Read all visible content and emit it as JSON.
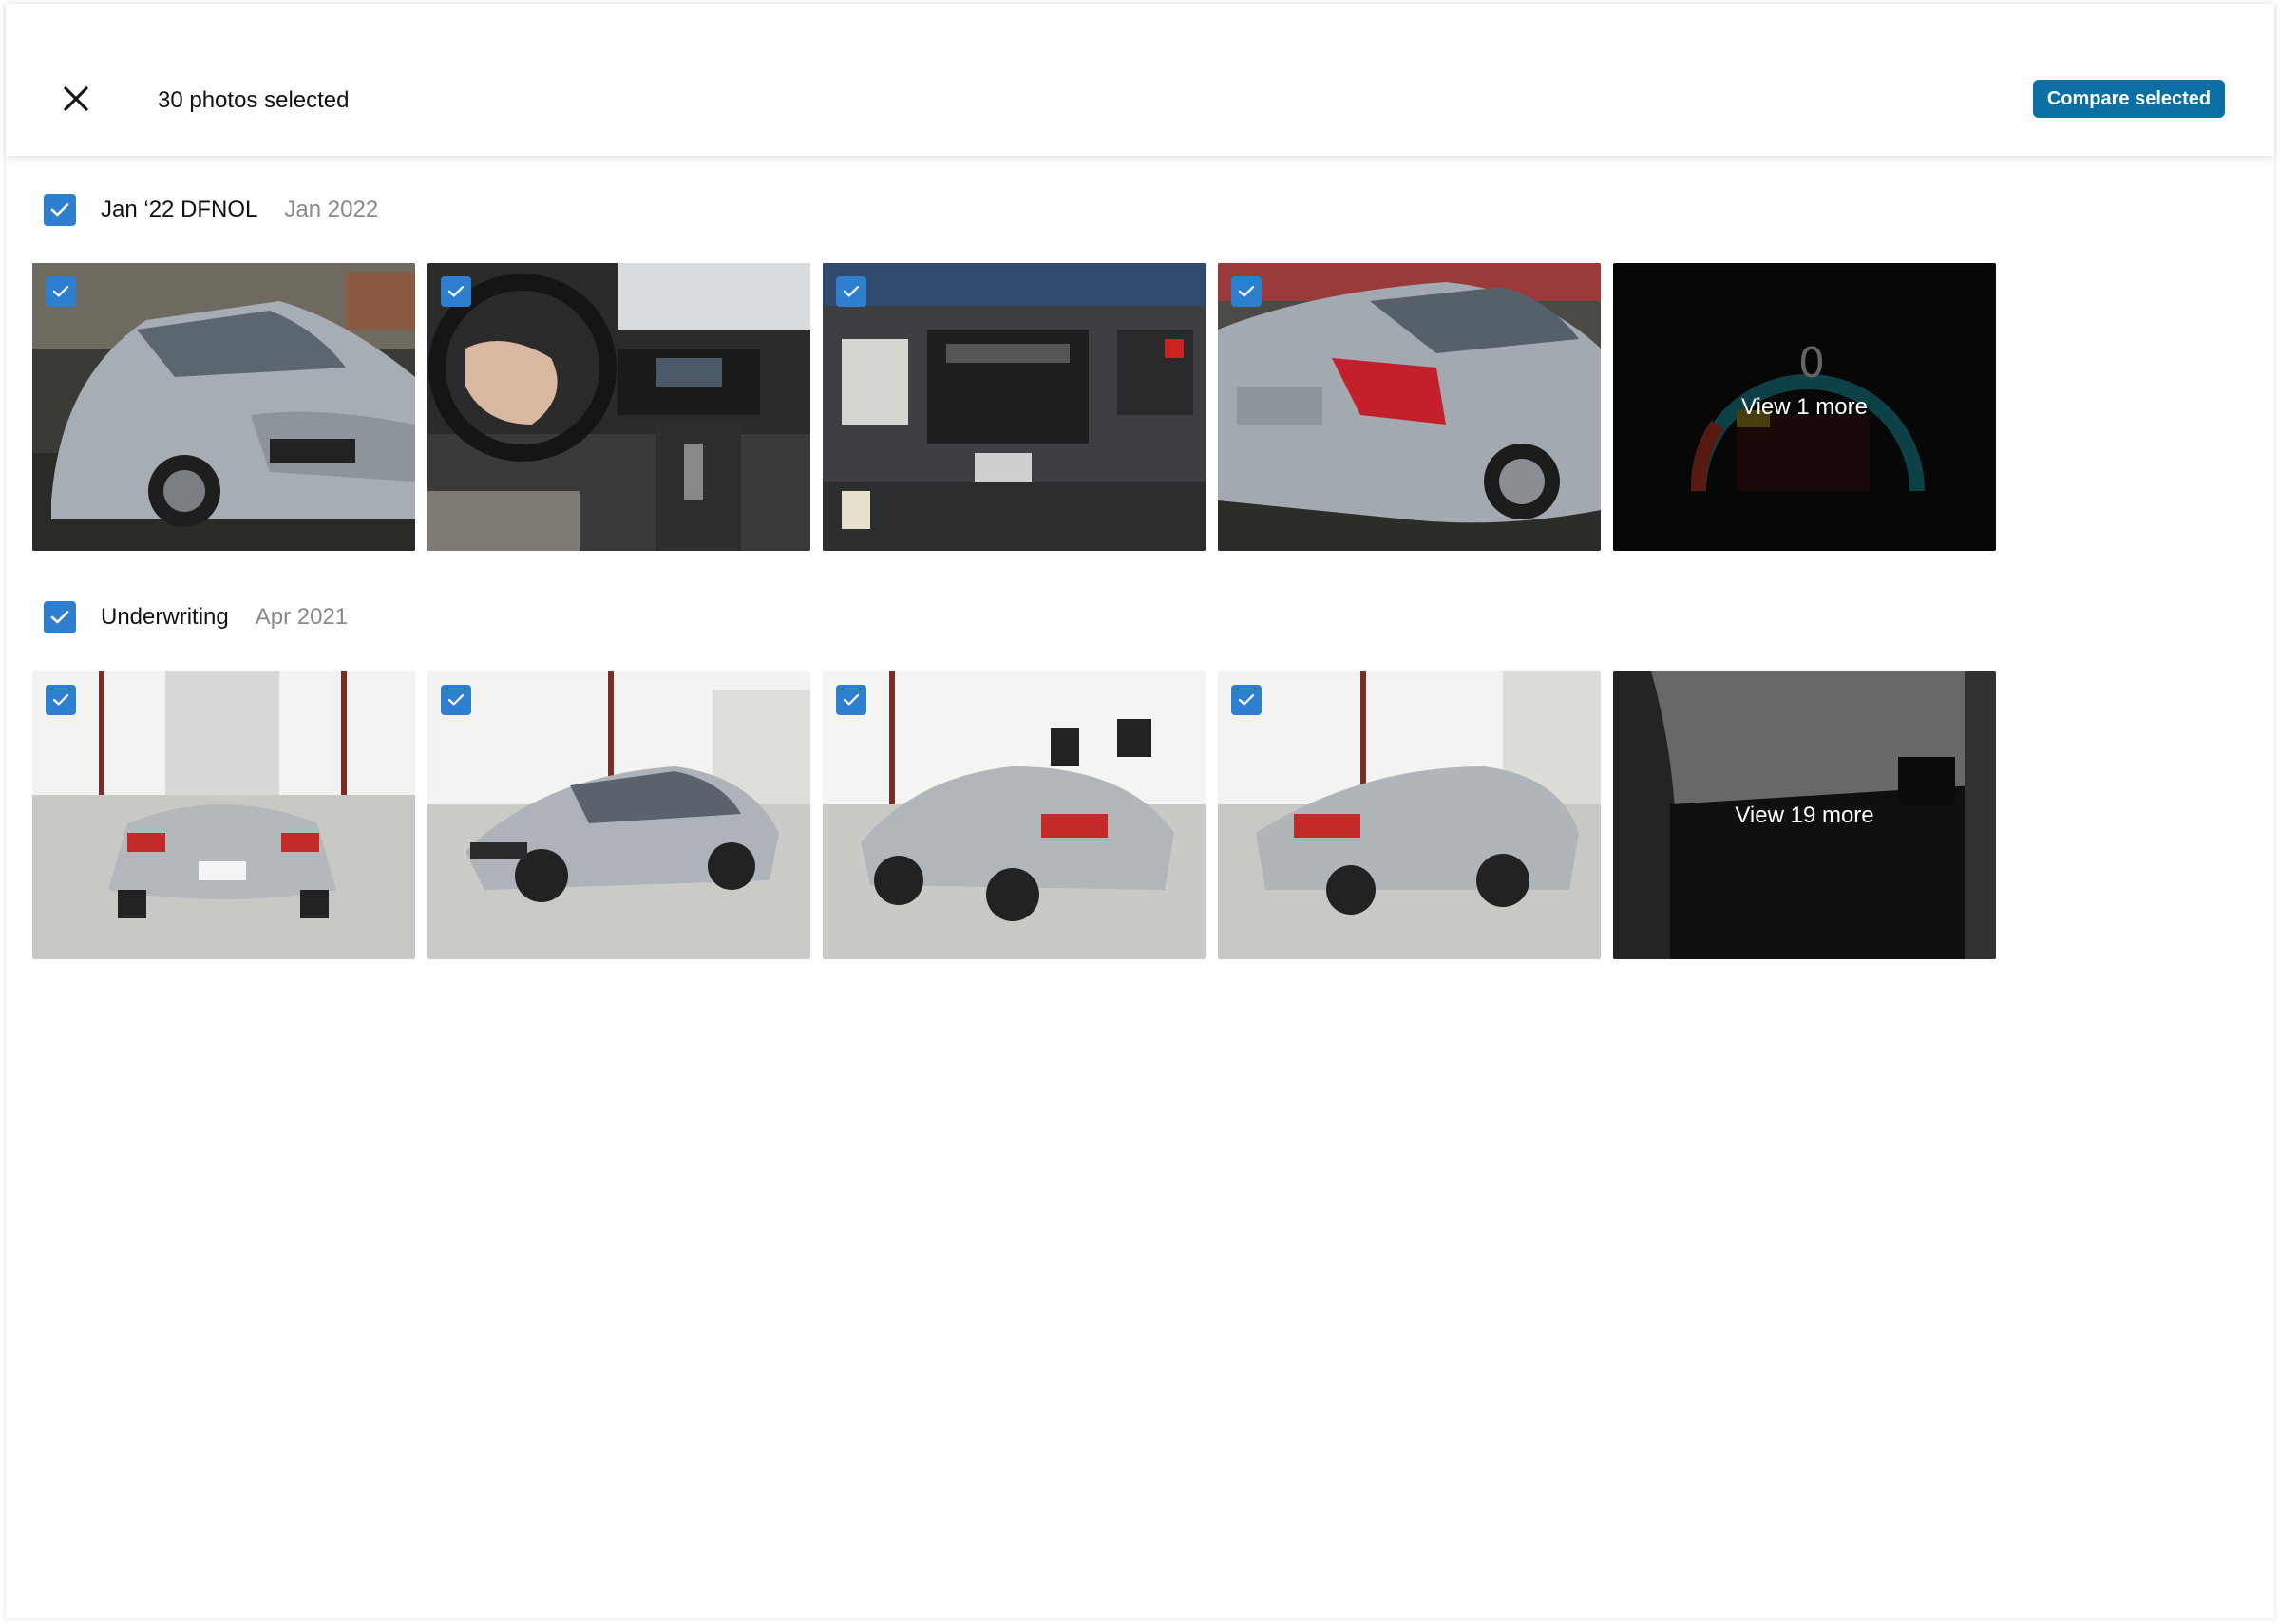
{
  "header": {
    "selection_count": "30 photos selected",
    "compare_label": "Compare selected"
  },
  "colors": {
    "accent": "#2f7fd1",
    "button": "#0b6fa4",
    "muted_text": "#8a8a8a"
  },
  "groups": [
    {
      "title": "Jan ‘22 DFNOL",
      "date": "Jan 2022",
      "checked": true,
      "photos": [
        "front-damage",
        "interior-airbag",
        "engine-bay",
        "rear-quarter"
      ],
      "more_label": "View 1 more"
    },
    {
      "title": "Underwriting",
      "date": "Apr 2021",
      "checked": true,
      "photos": [
        "rear-studio",
        "front-three-quarter",
        "rear-three-quarter-left",
        "rear-three-quarter-right"
      ],
      "more_label": "View 19 more"
    }
  ]
}
